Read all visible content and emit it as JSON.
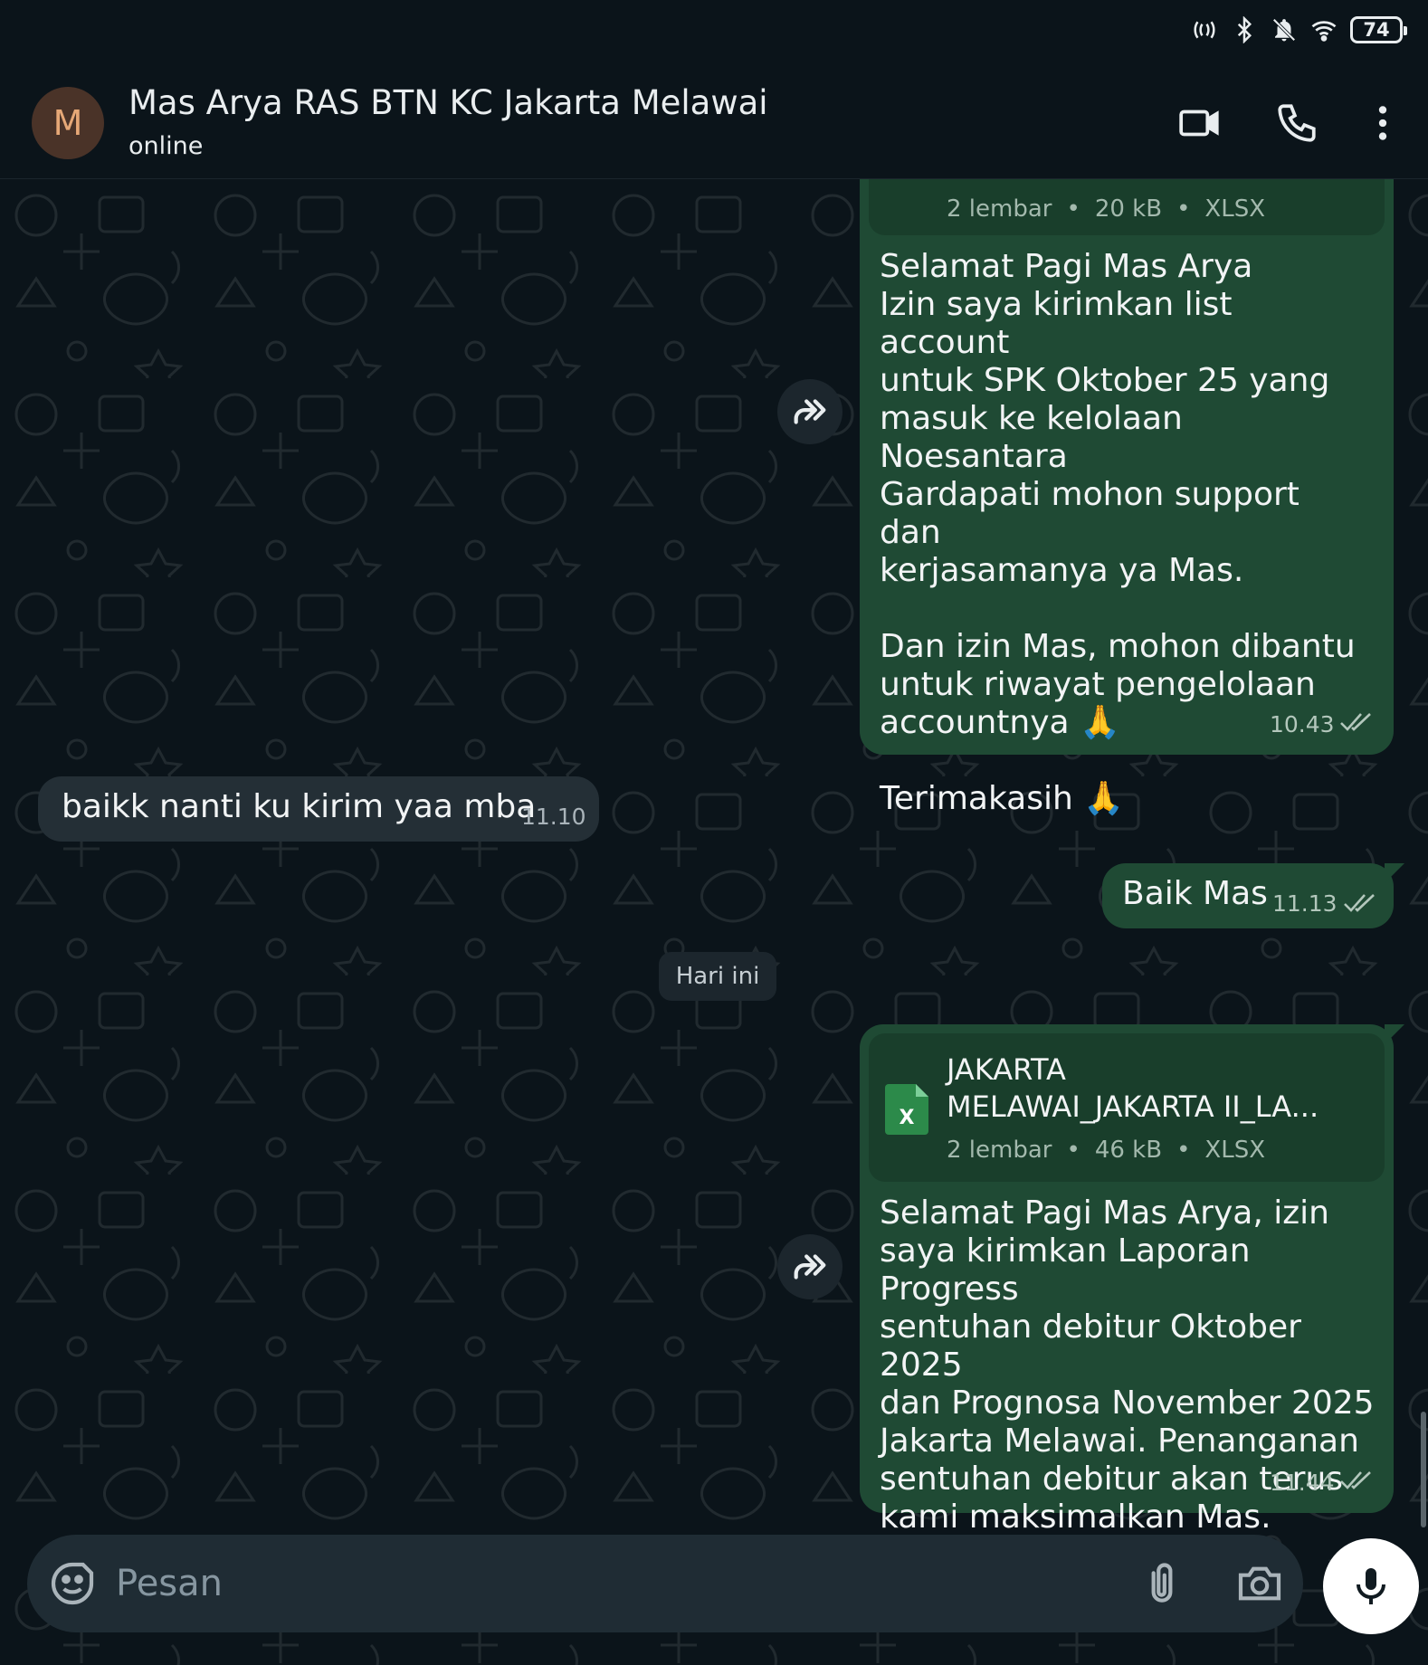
{
  "status_bar": {
    "battery": "74"
  },
  "header": {
    "avatar_letter": "M",
    "contact_name": "Mas Arya RAS BTN KC Jakarta Melawai",
    "contact_status": "online"
  },
  "messages": [
    {
      "direction": "out",
      "doc": {
        "pages": "2 lembar",
        "size": "20 kB",
        "type": "XLSX"
      },
      "text": "Selamat Pagi Mas Arya\nIzin saya kirimkan list account\nuntuk SPK Oktober 25 yang\nmasuk ke kelolaan Noesantara\nGardapati mohon support dan\nkerjasamanya ya Mas.\n\nDan izin Mas, mohon dibantu\nuntuk riwayat pengelolaan\naccountnya 🙏\n\nTerimakasih 🙏",
      "time": "10.43"
    },
    {
      "direction": "in",
      "text": "baikk nanti ku kirim yaa mba",
      "time": "11.10"
    },
    {
      "direction": "out",
      "text": "Baik Mas",
      "time": "11.13"
    },
    {
      "direction": "out",
      "doc": {
        "name_line1": "JAKARTA",
        "name_line2": "MELAWAI_JAKARTA II_LA...",
        "pages": "2 lembar",
        "size": "46 kB",
        "type": "XLSX"
      },
      "text": "Selamat Pagi Mas Arya, izin\nsaya kirimkan Laporan Progress\nsentuhan debitur Oktober 2025\ndan Prognosa November 2025\nJakarta Melawai. Penanganan\nsentuhan debitur akan terus\nkami maksimalkan Mas.\nTerimakasih",
      "time": "11.44"
    }
  ],
  "date_divider": "Hari ini",
  "composer": {
    "placeholder": "Pesan"
  },
  "doc_separator": "•",
  "colors": {
    "outgoing_bubble": "#1f4a34",
    "incoming_bubble": "#242f36",
    "background": "#0b141a",
    "read_ticks": "#b3c7bc"
  }
}
